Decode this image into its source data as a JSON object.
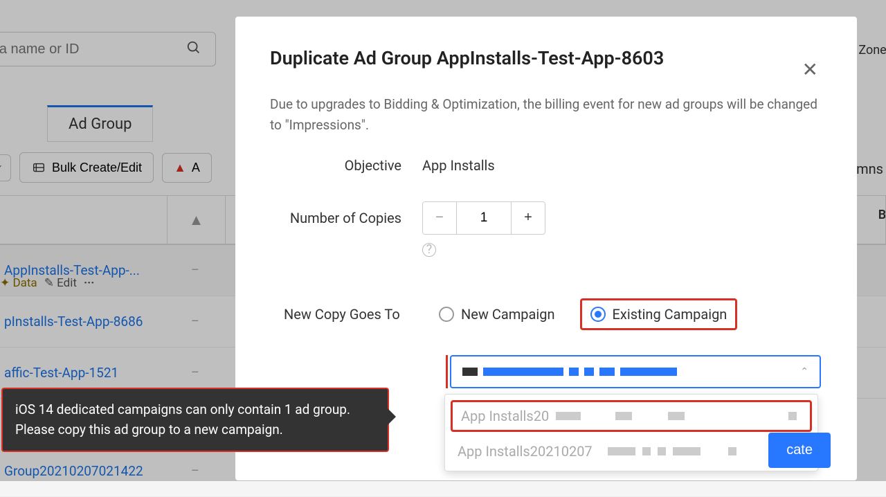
{
  "search": {
    "placeholder": "Search for a name or ID"
  },
  "zones_label": "Zones",
  "tab": {
    "label": "Ad Group"
  },
  "toolbar": {
    "bulk_label": "Bulk Create/Edit",
    "alert_label": "A"
  },
  "columns_label": "mns",
  "bid_header": "Bid",
  "rows": [
    {
      "name": "AppInstalls-Test-App-...",
      "data_label": "Data",
      "edit_label": "Edit"
    },
    {
      "name": "pInstalls-Test-App-8686"
    },
    {
      "name": "affic-Test-App-1521"
    },
    {
      "name": "Group20210207021422"
    }
  ],
  "modal": {
    "title": "Duplicate Ad Group AppInstalls-Test-App-8603",
    "subtitle": "Due to upgrades to Bidding & Optimization, the billing event for new ad groups will be changed to \"Impressions\".",
    "objective_label": "Objective",
    "objective_value": "App Installs",
    "copies_label": "Number of Copies",
    "copies_value": "1",
    "goesto_label": "New Copy Goes To",
    "radio_new": "New Campaign",
    "radio_existing": "Existing Campaign",
    "dropdown": {
      "item1": "App Installs20",
      "item2": "App Installs20210207"
    },
    "duplicate_btn": "cate"
  },
  "tooltip": {
    "text": "iOS 14 dedicated campaigns can only contain 1 ad group. Please copy this ad group to a new campaign."
  }
}
